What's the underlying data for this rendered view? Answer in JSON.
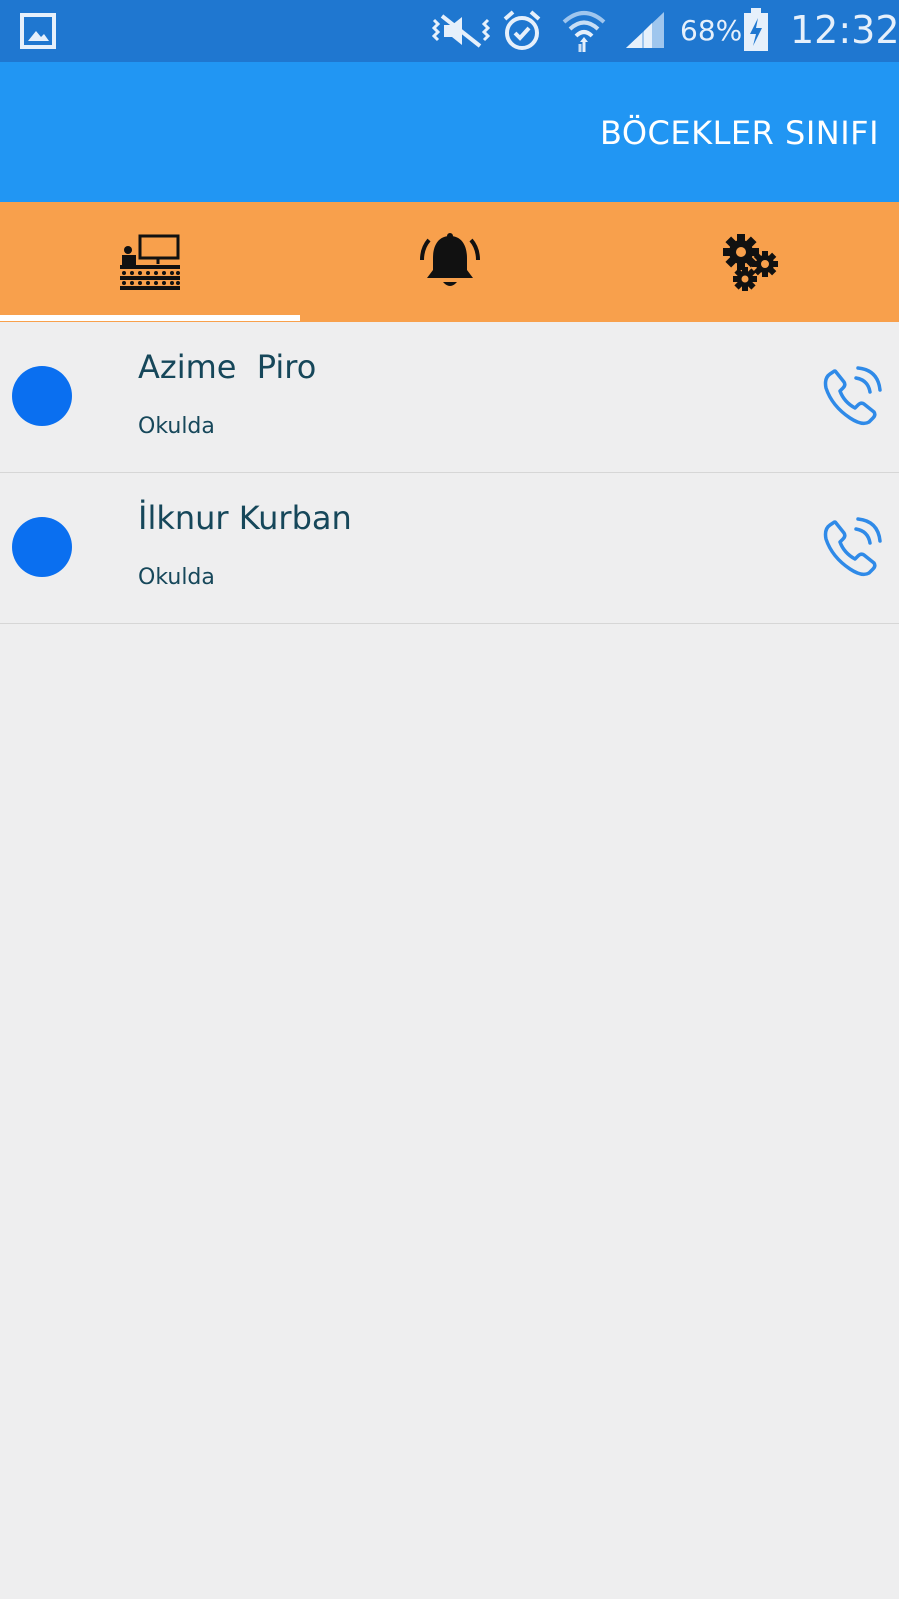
{
  "status_bar": {
    "battery_percent": "68%",
    "time": "12:32",
    "icons": [
      "gallery-icon",
      "vibrate-mute-icon",
      "alarm-icon",
      "wifi-icon",
      "signal-icon",
      "battery-charging-icon"
    ]
  },
  "app_bar": {
    "title": "BÖCEKLER SINIFI"
  },
  "tabs": [
    {
      "icon": "classroom-icon",
      "selected": true
    },
    {
      "icon": "bell-icon",
      "selected": false
    },
    {
      "icon": "gears-icon",
      "selected": false
    }
  ],
  "list": [
    {
      "name": "Azime  Piro",
      "status": "Okulda",
      "avatar_color": "#0a6ff0",
      "action_icon": "phone-call-icon"
    },
    {
      "name": "İlknur Kurban",
      "status": "Okulda",
      "avatar_color": "#0a6ff0",
      "action_icon": "phone-call-icon"
    }
  ],
  "colors": {
    "status_bar": "#1f77d0",
    "app_bar": "#2196f3",
    "tab_bar": "#f8a04c",
    "background": "#eeeeef",
    "text": "#16475a",
    "avatar": "#0a6ff0",
    "call_icon": "#2f8ae8"
  }
}
